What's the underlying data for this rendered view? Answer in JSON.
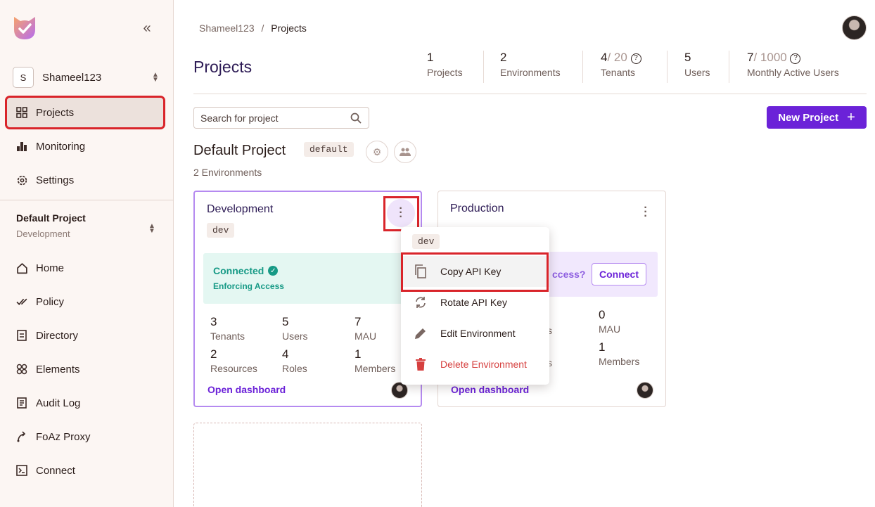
{
  "sidebar": {
    "org_initial": "S",
    "org_name": "Shameel123",
    "nav_top": [
      {
        "label": "Projects",
        "icon": "grid-icon"
      },
      {
        "label": "Monitoring",
        "icon": "bar-chart-icon"
      },
      {
        "label": "Settings",
        "icon": "gear-icon"
      }
    ],
    "project_title": "Default Project",
    "project_env": "Development",
    "nav_project": [
      {
        "label": "Home",
        "icon": "home-icon"
      },
      {
        "label": "Policy",
        "icon": "check-double-icon"
      },
      {
        "label": "Directory",
        "icon": "directory-icon"
      },
      {
        "label": "Elements",
        "icon": "elements-icon"
      },
      {
        "label": "Audit Log",
        "icon": "audit-log-icon"
      },
      {
        "label": "FoAz Proxy",
        "icon": "proxy-icon"
      },
      {
        "label": "Connect",
        "icon": "terminal-icon"
      }
    ]
  },
  "breadcrumb": {
    "org": "Shameel123",
    "sep": "/",
    "current": "Projects"
  },
  "page": {
    "title": "Projects"
  },
  "stats": [
    {
      "value": "1",
      "of": "",
      "label": "Projects"
    },
    {
      "value": "2",
      "of": "",
      "label": "Environments"
    },
    {
      "value": "4",
      "of": "/ 20",
      "label": "Tenants"
    },
    {
      "value": "5",
      "of": "",
      "label": "Users"
    },
    {
      "value": "7",
      "of": "/ 1000",
      "label": "Monthly Active Users"
    }
  ],
  "search": {
    "placeholder": "Search for project"
  },
  "new_project_label": "New Project",
  "project": {
    "name": "Default Project",
    "key": "default",
    "env_count": "2 Environments"
  },
  "cards": {
    "dev": {
      "title": "Development",
      "key": "dev",
      "status": "Connected",
      "status_sub": "Enforcing Access",
      "metrics": [
        {
          "n": "3",
          "t": "Tenants"
        },
        {
          "n": "5",
          "t": "Users"
        },
        {
          "n": "7",
          "t": "MAU"
        },
        {
          "n": "2",
          "t": "Resources"
        },
        {
          "n": "4",
          "t": "Roles"
        },
        {
          "n": "1",
          "t": "Members"
        }
      ],
      "open": "Open dashboard"
    },
    "prod": {
      "title": "Production",
      "banner_q": "ccess?",
      "connect": "Connect",
      "metric_partial_1": "s",
      "metric_partial_2": "s",
      "metrics": [
        {
          "n": "0",
          "t": "MAU"
        },
        {
          "n": "1",
          "t": "Members"
        }
      ],
      "open": "Open dashboard"
    }
  },
  "menu": {
    "key": "dev",
    "items": [
      {
        "label": "Copy API Key",
        "icon": "copy-icon"
      },
      {
        "label": "Rotate API Key",
        "icon": "rotate-icon"
      },
      {
        "label": "Edit Environment",
        "icon": "pencil-icon"
      },
      {
        "label": "Delete Environment",
        "icon": "trash-icon"
      }
    ]
  },
  "colors": {
    "accent": "#6b22d8",
    "success": "#179a86",
    "danger": "#d6403f",
    "highlight": "#d9242a"
  }
}
